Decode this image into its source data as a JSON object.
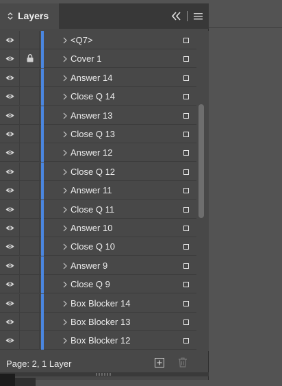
{
  "panel": {
    "tab_title": "Layers",
    "icons": {
      "tab_arrows": "up-down-arrows-icon",
      "collapse": "double-chevron-left-icon",
      "menu": "hamburger-menu-icon"
    }
  },
  "layers": [
    {
      "name": "<Q7>",
      "locked": false
    },
    {
      "name": "Cover 1",
      "locked": true
    },
    {
      "name": "Answer 14",
      "locked": false
    },
    {
      "name": "Close Q 14",
      "locked": false
    },
    {
      "name": "Answer 13",
      "locked": false
    },
    {
      "name": "Close Q 13",
      "locked": false
    },
    {
      "name": "Answer 12",
      "locked": false
    },
    {
      "name": "Close Q 12",
      "locked": false
    },
    {
      "name": "Answer 11",
      "locked": false
    },
    {
      "name": "Close Q 11",
      "locked": false
    },
    {
      "name": "Answer 10",
      "locked": false
    },
    {
      "name": "Close Q 10",
      "locked": false
    },
    {
      "name": "Answer 9",
      "locked": false
    },
    {
      "name": "Close Q 9",
      "locked": false
    },
    {
      "name": "Box Blocker 14",
      "locked": false
    },
    {
      "name": "Box Blocker 13",
      "locked": false
    },
    {
      "name": "Box Blocker 12",
      "locked": false
    }
  ],
  "layer_color": "#4a86e0",
  "scroll_position": 0.3,
  "footer": {
    "status": "Page: 2, 1 Layer",
    "icons": {
      "new_layer": "new-layer-icon",
      "delete": "trash-icon"
    }
  }
}
